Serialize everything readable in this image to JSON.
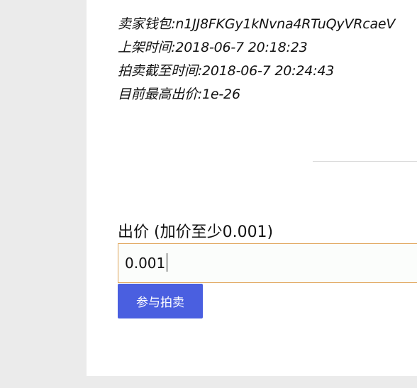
{
  "auction_info": {
    "seller_wallet_label": "卖家钱包:",
    "seller_wallet_value": "n1JJ8FKGy1kNvna4RTuQyVRcaeV",
    "listed_time_label": "上架时间:",
    "listed_time_value": "2018-06-7 20:18:23",
    "deadline_label": "拍卖截至时间:",
    "deadline_value": "2018-06-7 20:24:43",
    "highest_bid_label": "目前最高出价:",
    "highest_bid_value": "1e-26"
  },
  "bid_form": {
    "label": "出价 (加价至少0.001)",
    "input_value": "0.001",
    "submit_label": "参与拍卖"
  },
  "colors": {
    "page_background": "#ebebeb",
    "card_background": "#ffffff",
    "input_border": "#e0a458",
    "button_background": "#4a5fe0",
    "button_text": "#ffffff"
  }
}
